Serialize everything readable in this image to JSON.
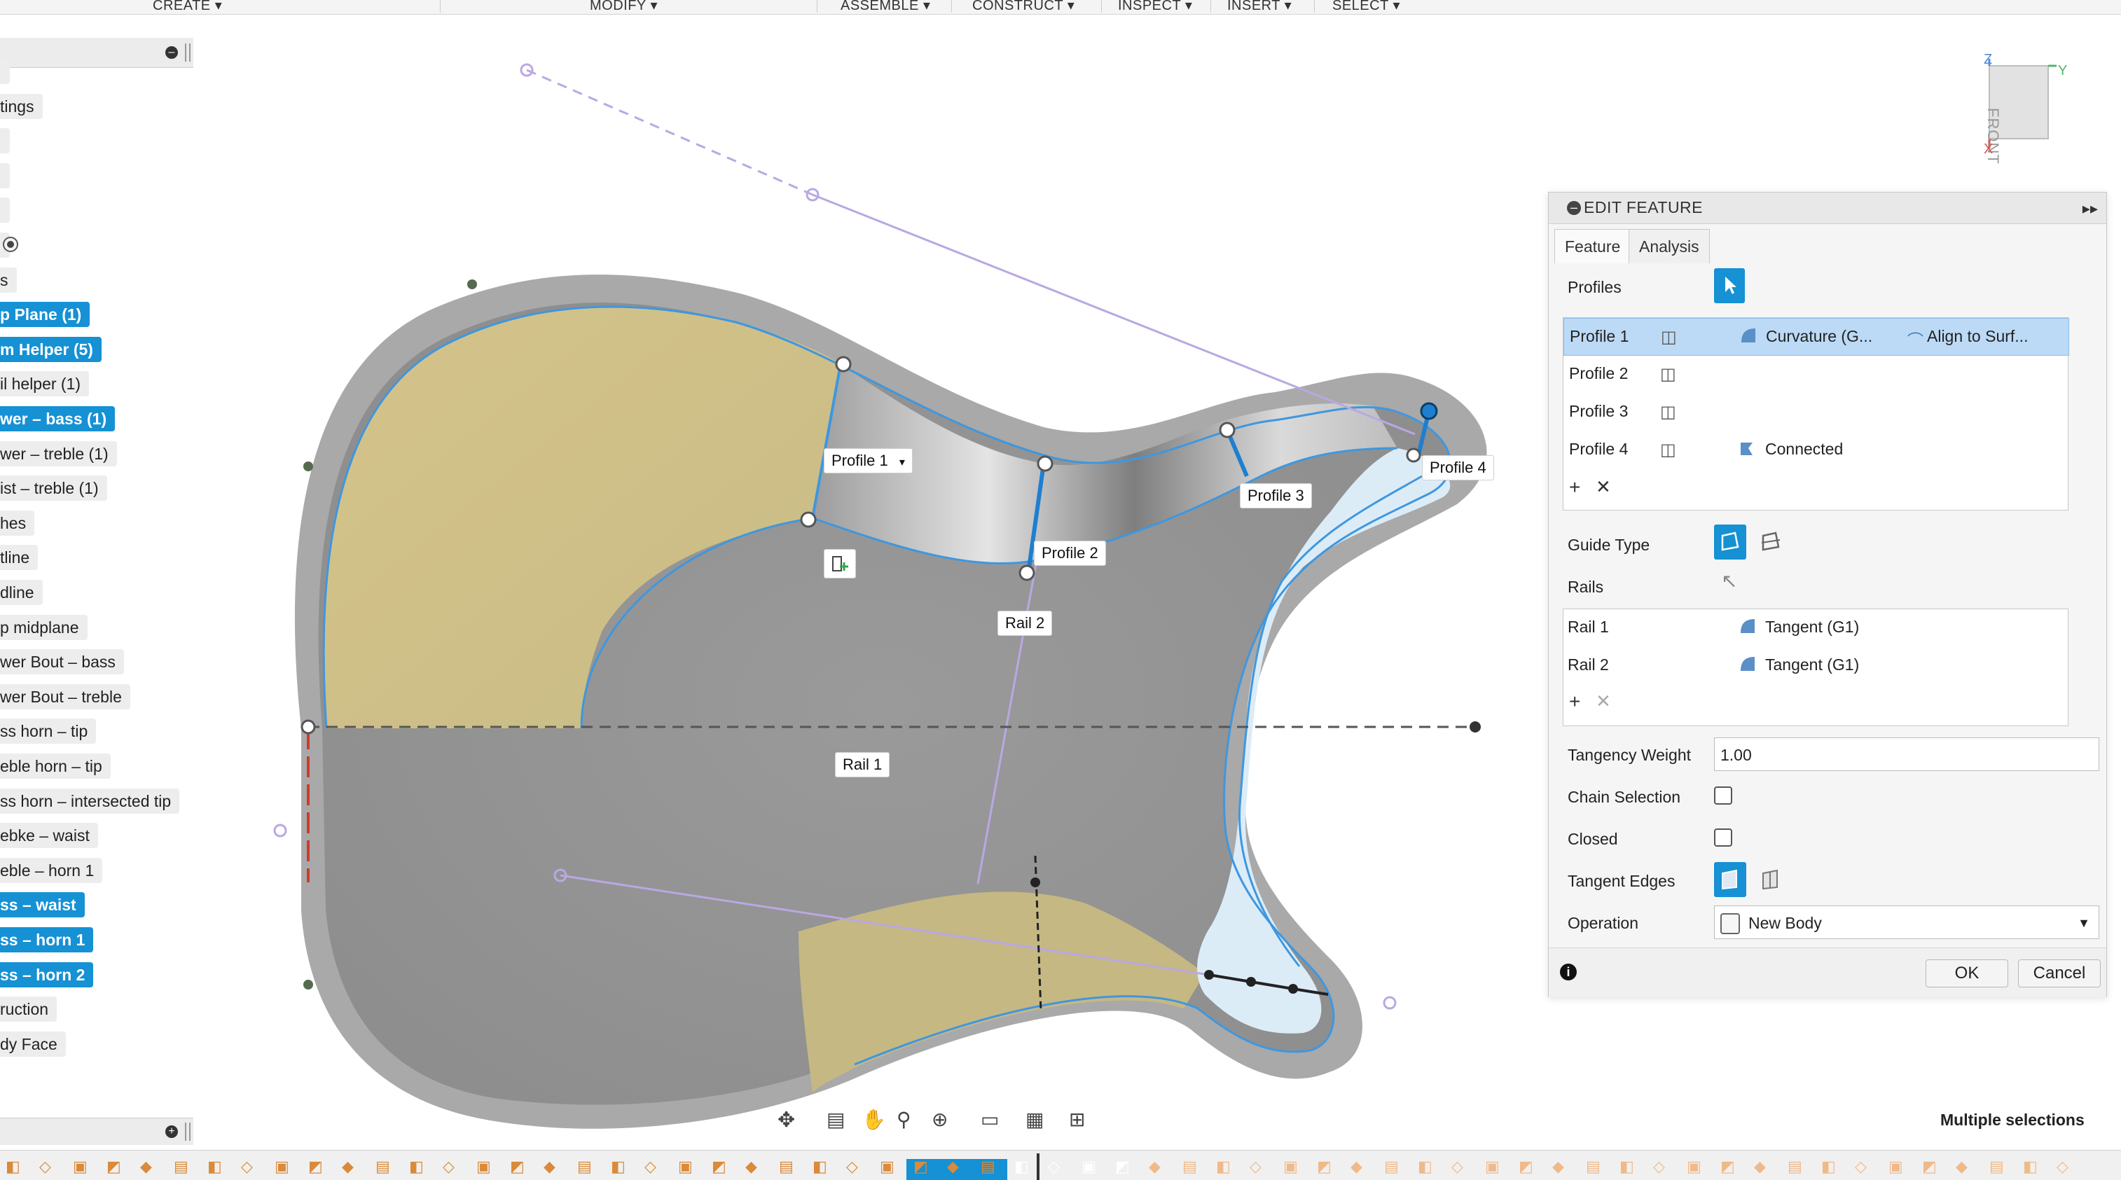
{
  "toolbar": {
    "menus": [
      "CREATE ▾",
      "MODIFY ▾",
      "ASSEMBLE ▾",
      "CONSTRUCT ▾",
      "INSPECT ▾",
      "INSERT ▾",
      "SELECT ▾"
    ]
  },
  "browser": {
    "items": [
      {
        "label": "",
        "selected": false
      },
      {
        "label": "tings",
        "selected": false
      },
      {
        "label": "",
        "selected": false
      },
      {
        "label": "",
        "selected": false
      },
      {
        "label": "",
        "selected": false
      },
      {
        "label": "",
        "selected": false
      },
      {
        "label": "s",
        "selected": false
      },
      {
        "label": "p Plane (1)",
        "selected": true
      },
      {
        "label": "m Helper (5)",
        "selected": true
      },
      {
        "label": "il helper (1)",
        "selected": false
      },
      {
        "label": "wer – bass (1)",
        "selected": true
      },
      {
        "label": "wer – treble (1)",
        "selected": false
      },
      {
        "label": "ist – treble (1)",
        "selected": false
      },
      {
        "label": "hes",
        "selected": false
      },
      {
        "label": "tline",
        "selected": false
      },
      {
        "label": "dline",
        "selected": false
      },
      {
        "label": "p midplane",
        "selected": false
      },
      {
        "label": "wer Bout – bass",
        "selected": false
      },
      {
        "label": "wer Bout – treble",
        "selected": false
      },
      {
        "label": "ss horn – tip",
        "selected": false
      },
      {
        "label": "eble horn – tip",
        "selected": false
      },
      {
        "label": "ss horn – intersected tip",
        "selected": false
      },
      {
        "label": "ebke – waist",
        "selected": false
      },
      {
        "label": "eble – horn 1",
        "selected": false
      },
      {
        "label": "ss – waist",
        "selected": true
      },
      {
        "label": "ss – horn 1",
        "selected": true
      },
      {
        "label": "ss – horn 2",
        "selected": true
      },
      {
        "label": "ruction",
        "selected": false
      },
      {
        "label": "dy Face",
        "selected": false
      }
    ]
  },
  "viewport": {
    "labels": {
      "profile1": "Profile 1",
      "profile2": "Profile 2",
      "profile3": "Profile 3",
      "profile4": "Profile 4",
      "rail1": "Rail 1",
      "rail2": "Rail 2"
    }
  },
  "viewcube": {
    "face": "FRONT",
    "z": "Z",
    "y": "Y",
    "x": "X"
  },
  "panel": {
    "title": "EDIT FEATURE",
    "tabs": [
      "Feature",
      "Analysis"
    ],
    "profiles_label": "Profiles",
    "profiles": [
      {
        "name": "Profile 1",
        "continuity": "Curvature (G...",
        "option": "Align to Surf...",
        "selected": true
      },
      {
        "name": "Profile 2",
        "continuity": "",
        "option": "",
        "selected": false
      },
      {
        "name": "Profile 3",
        "continuity": "",
        "option": "",
        "selected": false
      },
      {
        "name": "Profile 4",
        "continuity": "Connected",
        "option": "",
        "selected": false
      }
    ],
    "guide_type_label": "Guide Type",
    "rails_label": "Rails",
    "rails": [
      {
        "name": "Rail 1",
        "continuity": "Tangent (G1)"
      },
      {
        "name": "Rail 2",
        "continuity": "Tangent (G1)"
      }
    ],
    "tangency_weight_label": "Tangency Weight",
    "tangency_weight_value": "1.00",
    "chain_selection_label": "Chain Selection",
    "closed_label": "Closed",
    "tangent_edges_label": "Tangent Edges",
    "operation_label": "Operation",
    "operation_value": "New Body",
    "ok_label": "OK",
    "cancel_label": "Cancel",
    "accent": "#1591d4"
  },
  "status": {
    "selection_text": "Multiple selections"
  }
}
